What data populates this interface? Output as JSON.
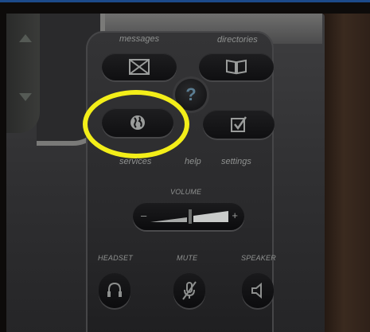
{
  "photo": {
    "description_free": true,
    "labels": {
      "messages": "messages",
      "directories": "directories",
      "services": "services",
      "help": "help",
      "settings": "settings",
      "volume": "VOLUME",
      "headset": "HEADSET",
      "mute": "MUTE",
      "speaker": "SPEAKER",
      "volume_minus": "–",
      "volume_plus": "+",
      "help_symbol": "?"
    },
    "colors": {
      "highlight_ring": "#f3ee19",
      "top_border": "#1c4a8a",
      "help_symbol": "#5b7d92"
    },
    "icons": [
      "envelope-icon",
      "book-icon",
      "globe-icon",
      "help-icon",
      "checklist-icon",
      "headset-icon",
      "mute-icon",
      "speaker-icon"
    ]
  }
}
